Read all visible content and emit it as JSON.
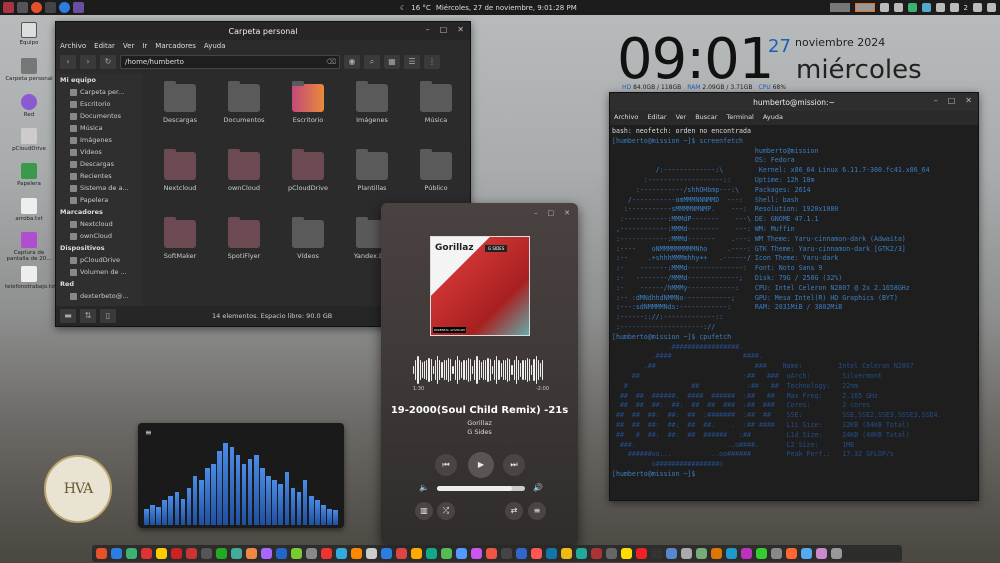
{
  "topbar": {
    "weather": "16 °C",
    "datetime": "Miércoles, 27 de noviembre, 9:01:28 PM",
    "volume_level": "2"
  },
  "desktop_icons": [
    "Equipo",
    "Carpeta personal",
    "Red",
    "pCloudDrive",
    "Papelera",
    "arroba.txt",
    "Captura de pantalla de 20...",
    "telefonotrabajo.txt"
  ],
  "file_manager": {
    "title": "Carpeta personal",
    "menu": [
      "Archivo",
      "Editar",
      "Ver",
      "Ir",
      "Marcadores",
      "Ayuda"
    ],
    "path": "/home/humberto",
    "sidebar": [
      {
        "header": "Mi equipo",
        "items": [
          "Carpeta per...",
          "Escritorio",
          "Documentos",
          "Música",
          "Imágenes",
          "Vídeos",
          "Descargas",
          "Recientes",
          "Sistema de a...",
          "Papelera"
        ]
      },
      {
        "header": "Marcadores",
        "items": [
          "Nextcloud",
          "ownCloud"
        ]
      },
      {
        "header": "Dispositivos",
        "items": [
          "pCloudDrive",
          "Volumen de ..."
        ]
      },
      {
        "header": "Red",
        "items": [
          "dexterbeto@..."
        ]
      }
    ],
    "files": [
      "Descargas",
      "Documentos",
      "Escritorio",
      "Imágenes",
      "Música",
      "Nextcloud",
      "ownCloud",
      "pCloudDrive",
      "Plantillas",
      "Público",
      "SoftMaker",
      "SpotiFlyer",
      "Vídeos",
      "Yandex.D..."
    ],
    "status": "14 elementos. Espacio libre: 90.0 GB"
  },
  "clock": {
    "time": "09:01",
    "day": "27",
    "month_year": "noviembre 2024",
    "weekday": "miércoles",
    "stats": [
      {
        "label": "HD",
        "value": "84.0GB / 118GB"
      },
      {
        "label": "RAM",
        "value": "2.09GB / 3.71GB"
      },
      {
        "label": "CPU",
        "value": "68%"
      }
    ]
  },
  "terminal": {
    "title": "humberto@mission:~",
    "menu": [
      "Archivo",
      "Editar",
      "Ver",
      "Buscar",
      "Terminal",
      "Ayuda"
    ],
    "lines": [
      "bash: neofetch: orden no encontrada",
      "[humberto@mission ~]$ screenfetch",
      "                                    humberto@mission",
      "                                    OS: Fedora",
      "           /:-------------:\\         Kernel: x86_64 Linux 6.11.7-300.fc41.x86_64",
      "        :-------------------::      Uptime: 12h 10m",
      "      :-----------/shhOHbmp---:\\    Packages: 2614",
      "    /-----------omMMMNNNMMD  ---:   Shell: bash",
      "   :-----------sMMMMNMNMP.    ---:  Resolution: 1920x1080",
      "  :-----------:MMMdP-------    ---\\ DE: GNOME 47.1.1",
      " ,------------:MMMd--------    ---: WM: Muffin",
      " :------------:MMMd-------    .---: WM Theme: Yaru-cinnamon-dark (Adwaita)",
      " :----    oNMMMMMMMMMNho     .----: GTK Theme: Yaru-cinnamon-dark [GTK2/3]",
      " :--     .+shhhMMMmhhy++   .------/ Icon Theme: Yaru-dark",
      " :-    -------:MMMd--------------:  Font: Noto Sans 9",
      " :-   --------/MMMd-------------;   Disk: 79G / 250G (32%)",
      " :-    ------/hMMMy------------:    CPU: Intel Celeron N2807 @ 2x 2.1658GHz",
      " :-- :dMNdhhdNMMNo------------;     GPU: Mesa Intel(R) HD Graphics (BYT)",
      " :---:sdNMMMMNds:------------:      RAM: 2031MiB / 3802MiB",
      " :------:://:-------------::",
      " :---------------------://",
      "",
      "[humberto@mission ~]$ cpufetch",
      "",
      "              .#################.",
      "          .####                  ####.",
      "        .##                         ###    Name:         Intel Celeron N2807",
      "     ##                          :##   ###  uArch:        Silvermont",
      "   #                ##            :##   ##  Technology:   22nm",
      "  ##  ##  ######.  ####  ######  :##   ##   Max Freq:     2.165 GHz",
      "  ##  ##  ##:  ##:  ##  ##  ###  :##  ###   Cores:        2 cores",
      " ##  ##  ##:  ##:  ##  :#######  :##  ##    SSE:          SSE,SSE2,SSE3,SSSE3,SSE4.",
      " ##  ##  ##:  ##:  ##  ##.    .  :## ####   L1i Size:     32KB (64KB Total)",
      " ##   #  ##:  ##:  ##  ######   :##         L1d Size:     24KB (48KB Total)",
      "  ###.                       ..o####.       L2 Size:      1MB",
      "    ######oo...          ..oo######         Peak Perf.:   17.32 GFLOP/s",
      "          o################o",
      "",
      "[humberto@mission ~]$ "
    ]
  },
  "player": {
    "cover_title": "Gorillaz",
    "cover_subtitle": "G SIDES",
    "advisory": "PARENTAL ADVISORY",
    "elapsed": "1:30",
    "remaining": "-2:00",
    "track": "19-2000(Soul Child Remix) -21s",
    "artist": "Gorillaz",
    "album": "G Sides",
    "volume": 0.85
  },
  "visualizer": {
    "menu_icon": "≡",
    "levels": [
      0.2,
      0.25,
      0.22,
      0.3,
      0.35,
      0.4,
      0.32,
      0.45,
      0.6,
      0.55,
      0.7,
      0.75,
      0.9,
      1.0,
      0.95,
      0.85,
      0.75,
      0.8,
      0.85,
      0.7,
      0.6,
      0.55,
      0.5,
      0.65,
      0.45,
      0.4,
      0.55,
      0.35,
      0.3,
      0.25,
      0.2,
      0.18
    ]
  },
  "seal": {
    "monogram": "HVA",
    "ring_text": "HUMBERTO VILLAFUERTE ALVAREZ"
  },
  "colors": {
    "accent": "#1b5fb8",
    "terminal_cyan": "#3a7ec2"
  }
}
